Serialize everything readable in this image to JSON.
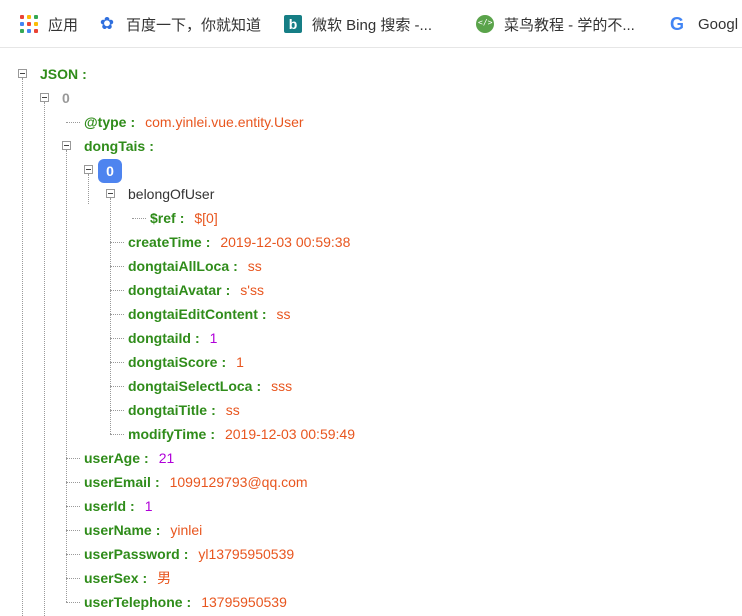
{
  "bookmarks": [
    {
      "label": "应用",
      "icon": "apps-grid-icon"
    },
    {
      "label": "百度一下，你就知道",
      "icon": "baidu-paw-icon"
    },
    {
      "label": "微软 Bing 搜索 -...",
      "icon": "bing-icon"
    },
    {
      "label": "菜鸟教程 - 学的不...",
      "icon": "runoob-icon"
    },
    {
      "label": "Googl",
      "icon": "google-icon"
    }
  ],
  "tree": {
    "root_key": "JSON",
    "colon": ":",
    "index0": "0",
    "type_key": "@type",
    "type_value": "com.yinlei.vue.entity.User",
    "dongtais_key": "dongTais",
    "dongtais_index": "0",
    "belong_key": "belongOfUser",
    "ref_key": "$ref",
    "ref_value": "$[0]",
    "dongtai_fields": [
      {
        "key": "createTime",
        "value": "2019-12-03 00:59:38",
        "kind": "str"
      },
      {
        "key": "dongtaiAllLoca",
        "value": "ss",
        "kind": "str"
      },
      {
        "key": "dongtaiAvatar",
        "value": "s'ss",
        "kind": "str"
      },
      {
        "key": "dongtaiEditContent",
        "value": "ss",
        "kind": "str"
      },
      {
        "key": "dongtaiId",
        "value": "1",
        "kind": "num"
      },
      {
        "key": "dongtaiScore",
        "value": "1",
        "kind": "str"
      },
      {
        "key": "dongtaiSelectLoca",
        "value": "sss",
        "kind": "str"
      },
      {
        "key": "dongtaiTitle",
        "value": "ss",
        "kind": "str"
      },
      {
        "key": "modifyTime",
        "value": "2019-12-03 00:59:49",
        "kind": "str"
      }
    ],
    "user_fields": [
      {
        "key": "userAge",
        "value": "21",
        "kind": "num"
      },
      {
        "key": "userEmail",
        "value": "1099129793@qq.com",
        "kind": "str"
      },
      {
        "key": "userId",
        "value": "1",
        "kind": "num"
      },
      {
        "key": "userName",
        "value": "yinlei",
        "kind": "str"
      },
      {
        "key": "userPassword",
        "value": "yl13795950539",
        "kind": "str"
      },
      {
        "key": "userSex",
        "value": "男",
        "kind": "str"
      },
      {
        "key": "userTelephone",
        "value": "13795950539",
        "kind": "str"
      }
    ]
  },
  "colors": {
    "key": "#2f8c1a",
    "string": "#e8561f",
    "number": "#b000d9",
    "badge": "#4e84ef"
  }
}
